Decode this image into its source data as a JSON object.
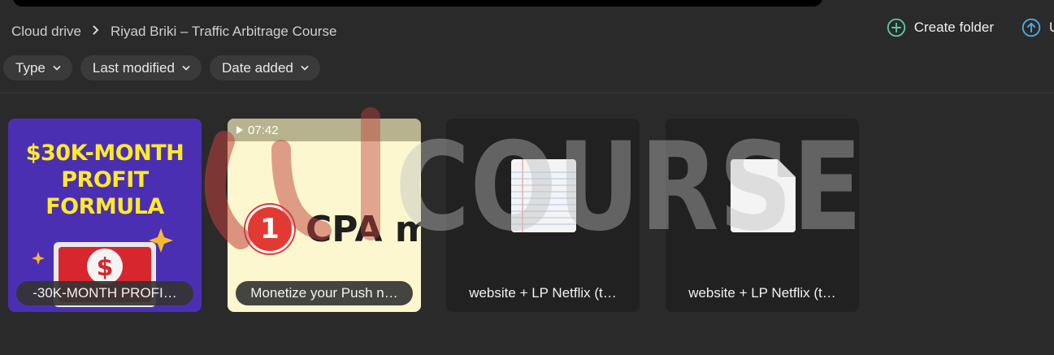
{
  "breadcrumb": {
    "root": "Cloud drive",
    "current": "Riyad Briki – Traffic Arbitrage Course"
  },
  "actions": {
    "create_folder": "Create folder",
    "upload": "U"
  },
  "filters": [
    {
      "label": "Type"
    },
    {
      "label": "Last modified"
    },
    {
      "label": "Date added"
    }
  ],
  "files": [
    {
      "name": "-30K-MONTH PROFI…",
      "thumb_text": [
        "$30K-MONTH",
        "PROFIT",
        "FORMULA"
      ]
    },
    {
      "name": "Monetize your Push n…",
      "duration": "07:42",
      "thumb_number": "1",
      "thumb_text": "CPA m"
    },
    {
      "name": "website + LP Netflix (t…",
      "icon": "lined-document-icon"
    },
    {
      "name": "website + LP Netflix (t…",
      "icon": "blank-document-icon"
    }
  ],
  "watermark": {
    "text": "COURSE"
  },
  "colors": {
    "background": "#2a2a2a",
    "create_folder_icon": "#5cc6a3",
    "upload_icon": "#4aa9e8",
    "thumb1_bg": "#4b2fb3",
    "thumb1_text": "#ffea2a",
    "thumb2_bg": "#fcf7cf"
  }
}
